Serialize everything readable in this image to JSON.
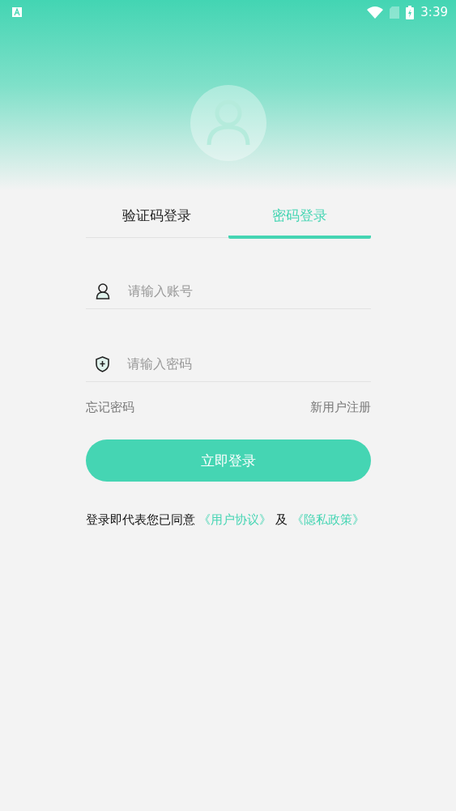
{
  "status_bar": {
    "time": "3:39"
  },
  "tabs": [
    {
      "label": "验证码登录",
      "selected": false
    },
    {
      "label": "密码登录",
      "selected": true
    }
  ],
  "fields": [
    {
      "kind": "account",
      "placeholder": "请输入账号"
    },
    {
      "kind": "password",
      "placeholder": "请输入密码"
    }
  ],
  "forgot_password": "忘记密码",
  "register": "新用户注册",
  "login_button": "立即登录",
  "agreement": {
    "text": "登录即代表您已同意",
    "user_agreement": "《用户协议》",
    "conjunction": "及",
    "privacy_policy": "《隐私政策》"
  }
}
